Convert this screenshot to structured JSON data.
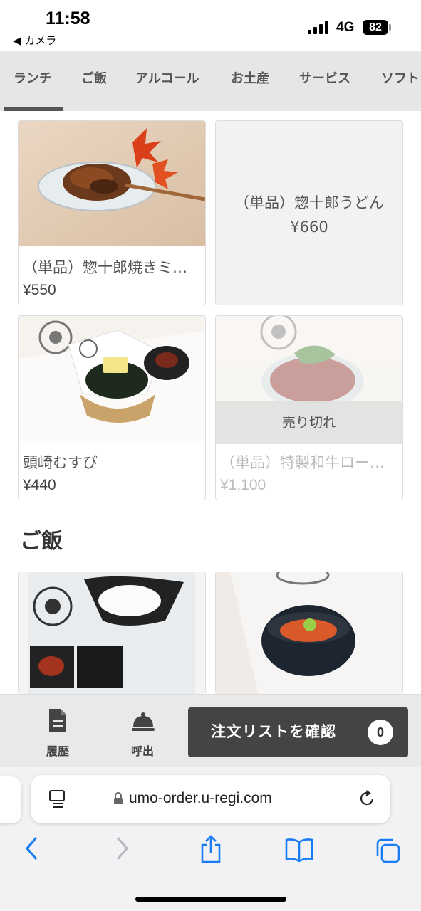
{
  "status_bar": {
    "time": "11:58",
    "back_app": "◀ カメラ",
    "network": "4G",
    "battery": "82"
  },
  "tabs": [
    {
      "label": "ランチ",
      "active": true
    },
    {
      "label": "ご飯",
      "active": false
    },
    {
      "label": "アルコール",
      "active": false
    },
    {
      "label": "お土産",
      "active": false
    },
    {
      "label": "サービス",
      "active": false
    },
    {
      "label": "ソフト",
      "active": false
    }
  ],
  "products": [
    {
      "name": "（単品）惣十郎焼きミ…",
      "price": "¥550"
    },
    {
      "name": "（単品）惣十郎うどん",
      "price": "¥660"
    },
    {
      "name": "頭崎むすび",
      "price": "¥440"
    },
    {
      "name": "（単品）特製和牛ロー…",
      "price": "¥1,100",
      "badge": "売り切れ"
    }
  ],
  "sections": {
    "gohan_title": "ご飯"
  },
  "order_bar": {
    "history_label": "履歴",
    "call_label": "呼出",
    "confirm_label": "注文リストを確認",
    "count": "0"
  },
  "browser": {
    "url": "umo-order.u-regi.com"
  },
  "colors": {
    "tab_bg": "#e6e6e6",
    "button_dark": "#444444",
    "ios_blue": "#1a7cf4"
  }
}
